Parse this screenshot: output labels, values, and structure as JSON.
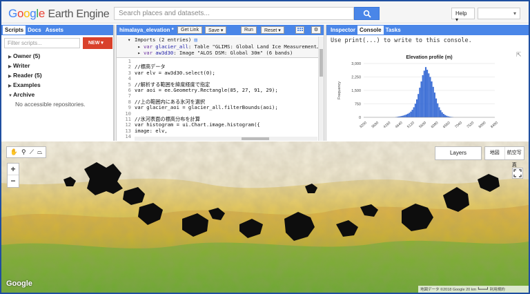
{
  "topbar": {
    "logo_google": [
      "G",
      "o",
      "o",
      "g",
      "l",
      "e"
    ],
    "logo_rest": "Earth Engine",
    "search_placeholder": "Search places and datasets...",
    "help_label": "Help",
    "search_icon": "search-icon"
  },
  "left_panel": {
    "tabs": [
      "Scripts",
      "Docs",
      "Assets"
    ],
    "filter_placeholder": "Filter scripts...",
    "new_label": "NEW",
    "tree": [
      {
        "label": "Owner (5)",
        "expanded": false
      },
      {
        "label": "Writer",
        "expanded": false
      },
      {
        "label": "Reader (5)",
        "expanded": false
      },
      {
        "label": "Examples",
        "expanded": false
      },
      {
        "label": "Archive",
        "expanded": true
      }
    ],
    "archive_note": "No accessible repositories."
  },
  "editor": {
    "title": "himalaya_elevation *",
    "buttons": {
      "get_link": "Get Link",
      "save": "Save",
      "run": "Run",
      "reset": "Reset"
    },
    "imports_header": "Imports (2 entries)",
    "imports": [
      {
        "prefix": "var",
        "name": "glacier_all",
        "rest": ": Table \"GLIMS: Global Land Ice Measurement…"
      },
      {
        "prefix": "var",
        "name": "aw3d30",
        "rest": ": Image \"ALOS DSM: Global 30m\" (6 bands)"
      }
    ],
    "code_lines": [
      {
        "n": "1",
        "t": ""
      },
      {
        "n": "2",
        "t": "//標高データ",
        "k": "comment"
      },
      {
        "n": "3",
        "t": "var elv = aw3d30.select(0);"
      },
      {
        "n": "4",
        "t": ""
      },
      {
        "n": "5",
        "t": "//解析する範囲を緯度経度で指定",
        "k": "comment"
      },
      {
        "n": "6",
        "t": "var aoi = ee.Geometry.Rectangle(85, 27, 91, 29);"
      },
      {
        "n": "7",
        "t": ""
      },
      {
        "n": "8",
        "t": "//上の範囲内にある氷河を選択",
        "k": "comment"
      },
      {
        "n": "9",
        "t": "var glacier_aoi = glacier_all.filterBounds(aoi);"
      },
      {
        "n": "10",
        "t": ""
      },
      {
        "n": "11",
        "t": "//氷河表面の標高分布を計算",
        "k": "comment"
      },
      {
        "n": "12",
        "t": "var histogram = ui.Chart.image.histogram({"
      },
      {
        "n": "13",
        "t": "  image: elv,"
      },
      {
        "n": "14",
        "t": ""
      }
    ]
  },
  "right_panel": {
    "tabs": [
      "Inspector",
      "Console",
      "Tasks"
    ],
    "active_tab": "Console",
    "console_message": "Use print(...) to write to this console."
  },
  "chart_data": {
    "type": "bar",
    "title": "Elevation profile (m)",
    "ylabel": "Frequency",
    "xlabel": "",
    "ylim": [
      0,
      3000
    ],
    "y_ticks": [
      "3,000",
      "2,250",
      "1,500",
      "750",
      "0"
    ],
    "x_ticks": [
      "3200",
      "3680",
      "4160",
      "4640",
      "5120",
      "5600",
      "6080",
      "6560",
      "7040",
      "7520",
      "8000",
      "8480"
    ],
    "xlim": [
      3200,
      8480
    ],
    "bar_color": "#3d6fd6",
    "bins": [
      {
        "x": 4500,
        "y": 15
      },
      {
        "x": 4560,
        "y": 30
      },
      {
        "x": 4620,
        "y": 45
      },
      {
        "x": 4680,
        "y": 60
      },
      {
        "x": 4740,
        "y": 80
      },
      {
        "x": 4800,
        "y": 100
      },
      {
        "x": 4860,
        "y": 130
      },
      {
        "x": 4920,
        "y": 160
      },
      {
        "x": 4980,
        "y": 200
      },
      {
        "x": 5040,
        "y": 250
      },
      {
        "x": 5100,
        "y": 320
      },
      {
        "x": 5160,
        "y": 420
      },
      {
        "x": 5220,
        "y": 560
      },
      {
        "x": 5280,
        "y": 760
      },
      {
        "x": 5340,
        "y": 1000
      },
      {
        "x": 5400,
        "y": 1300
      },
      {
        "x": 5460,
        "y": 1650
      },
      {
        "x": 5520,
        "y": 2000
      },
      {
        "x": 5580,
        "y": 2350
      },
      {
        "x": 5640,
        "y": 2600
      },
      {
        "x": 5700,
        "y": 2800
      },
      {
        "x": 5760,
        "y": 2650
      },
      {
        "x": 5820,
        "y": 2450
      },
      {
        "x": 5880,
        "y": 2250
      },
      {
        "x": 5940,
        "y": 2000
      },
      {
        "x": 6000,
        "y": 1700
      },
      {
        "x": 6060,
        "y": 1380
      },
      {
        "x": 6120,
        "y": 1050
      },
      {
        "x": 6180,
        "y": 780
      },
      {
        "x": 6240,
        "y": 560
      },
      {
        "x": 6300,
        "y": 400
      },
      {
        "x": 6360,
        "y": 280
      },
      {
        "x": 6420,
        "y": 190
      },
      {
        "x": 6480,
        "y": 130
      },
      {
        "x": 6540,
        "y": 90
      },
      {
        "x": 6600,
        "y": 60
      },
      {
        "x": 6660,
        "y": 40
      },
      {
        "x": 6720,
        "y": 25
      },
      {
        "x": 6780,
        "y": 15
      }
    ]
  },
  "map": {
    "layers_label": "Layers",
    "maptype_options": [
      "地図",
      "航空写真"
    ],
    "zoom_in": "+",
    "zoom_out": "−",
    "google_logo": "Google",
    "attribution": "地図データ ©2018 Google   20 km ┗━━━┛   利用規約"
  }
}
